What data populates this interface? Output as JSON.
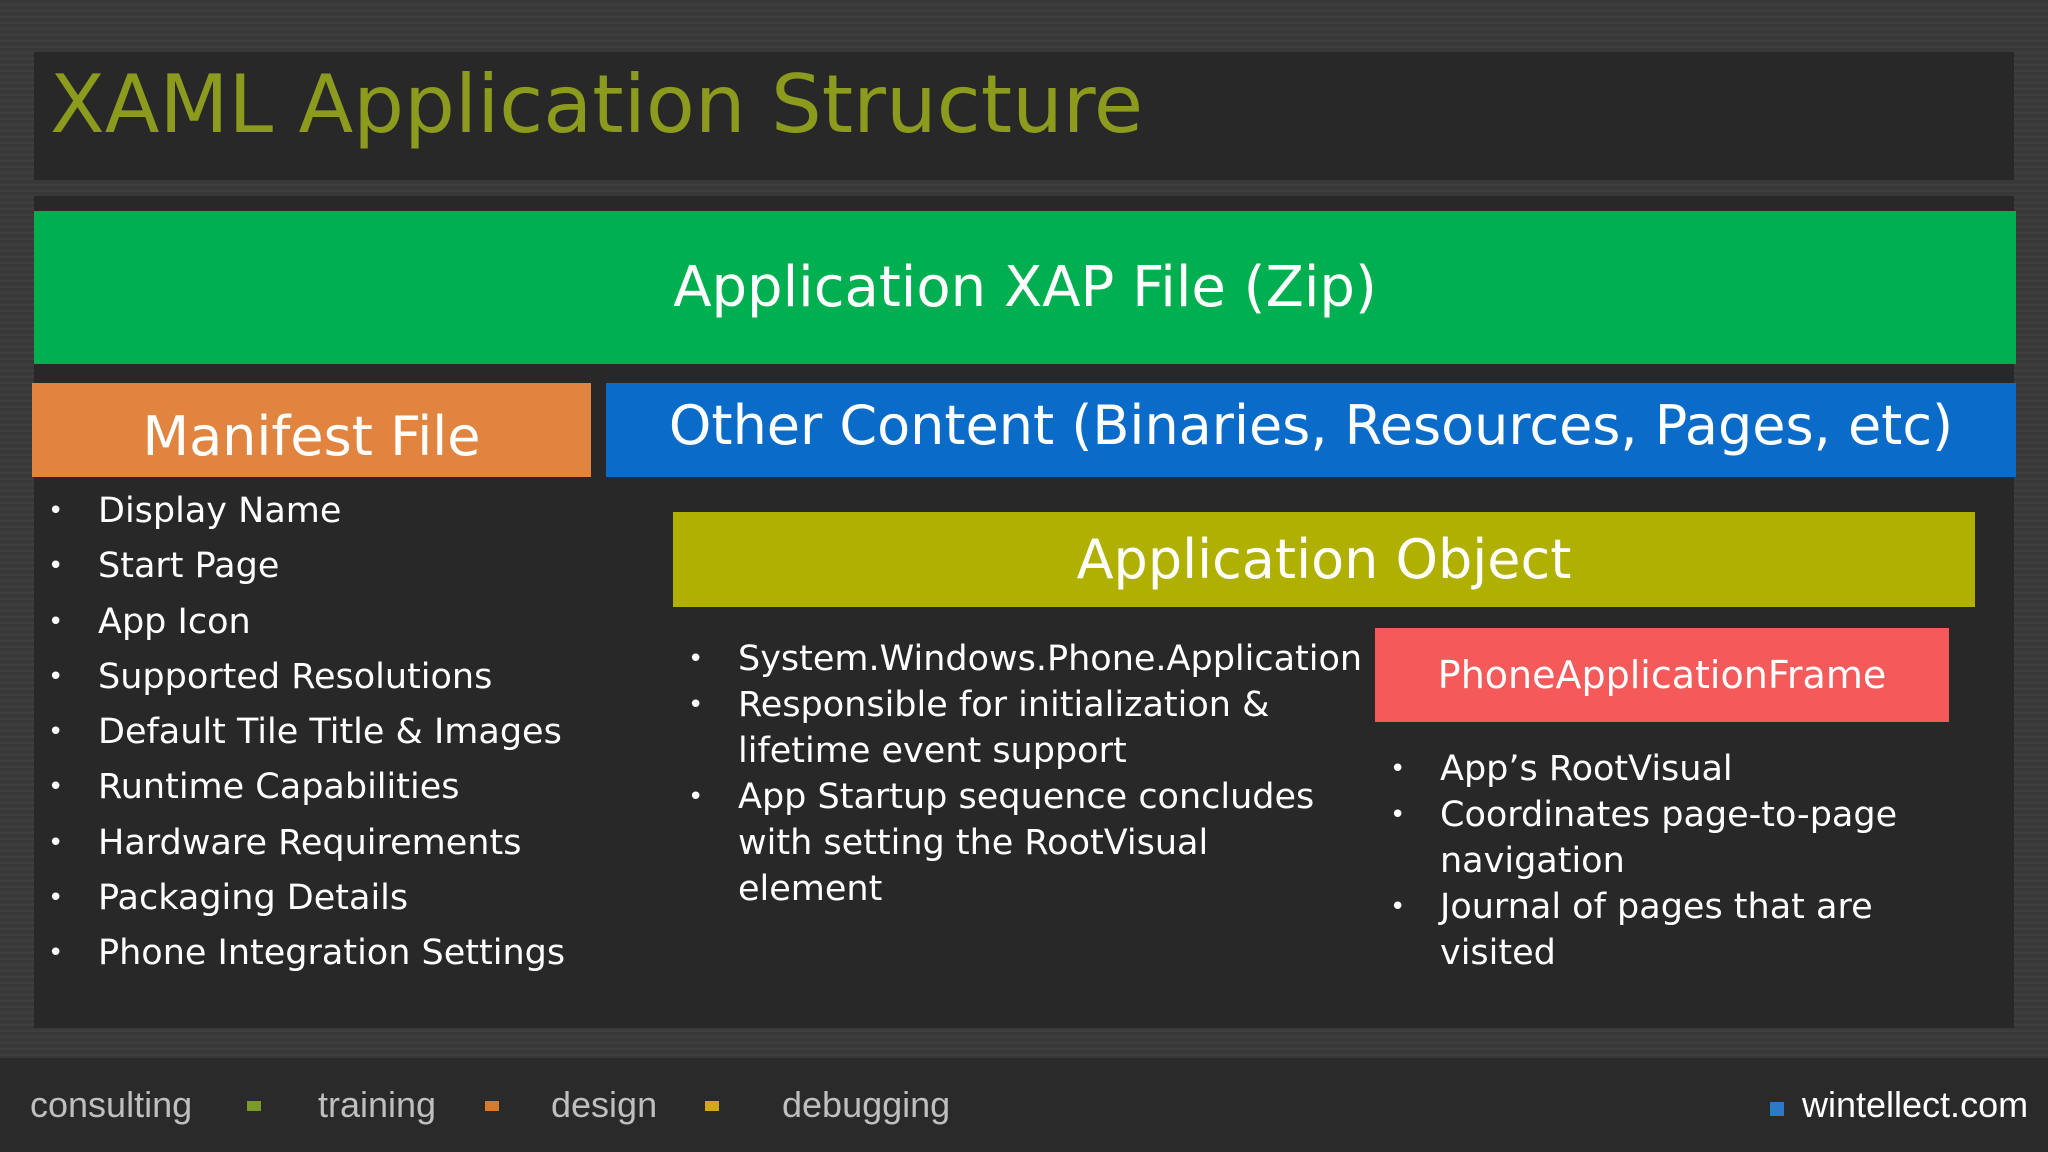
{
  "slide": {
    "title": "XAML Application Structure"
  },
  "boxes": {
    "xap": "Application XAP File (Zip)",
    "manifest": "Manifest File",
    "other": "Other Content (Binaries, Resources, Pages, etc)",
    "app_object": "Application Object",
    "frame": "PhoneApplicationFrame"
  },
  "manifest_items": [
    "Display Name",
    "Start Page",
    "App Icon",
    "Supported Resolutions",
    "Default Tile Title & Images",
    "Runtime Capabilities",
    "Hardware Requirements",
    "Packaging Details",
    "Phone Integration Settings"
  ],
  "app_object_items": [
    "System.Windows.Phone.Application",
    "Responsible for initialization & lifetime event support",
    "App Startup sequence concludes with setting the RootVisual element"
  ],
  "frame_items": [
    "App’s RootVisual",
    "Coordinates page-to-page navigation",
    "Journal of pages that are visited"
  ],
  "footer": {
    "items": [
      "consulting",
      "training",
      "design",
      "debugging"
    ],
    "site": "wintellect.com"
  },
  "colors": {
    "title": "#8c9a1e",
    "xap": "#00b050",
    "manifest": "#e0843f",
    "other": "#0a6cc8",
    "app_object": "#b0b000",
    "frame": "#f45a5a"
  }
}
